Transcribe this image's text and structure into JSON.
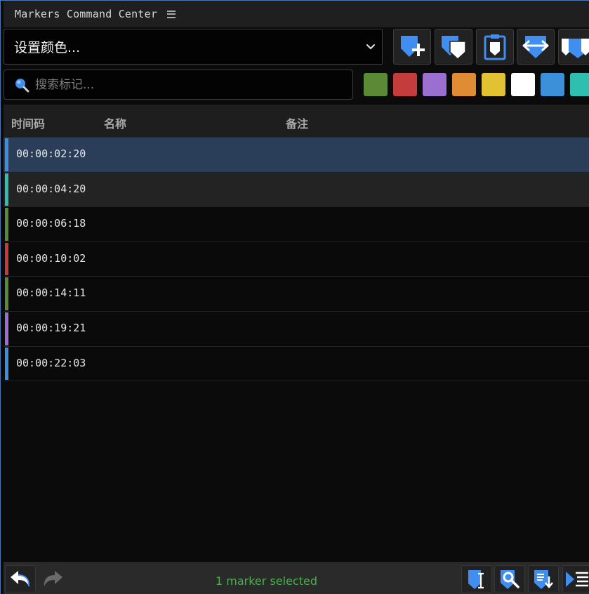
{
  "window": {
    "title": "Markers Command Center"
  },
  "toolbar": {
    "color_select": {
      "label": "设置颜色..."
    },
    "buttons": [
      {
        "name": "add-marker-button",
        "icon": "marker-add-icon"
      },
      {
        "name": "marker-button",
        "icon": "marker-icon"
      },
      {
        "name": "clipboard-marker-button",
        "icon": "clipboard-marker-icon"
      },
      {
        "name": "swap-marker-button",
        "icon": "marker-swap-icon"
      },
      {
        "name": "marker-range-button",
        "icon": "marker-range-icon"
      }
    ]
  },
  "search": {
    "placeholder": "搜索标记..."
  },
  "swatches": [
    "#5b8a36",
    "#c43c3c",
    "#9b6fcf",
    "#e08c34",
    "#e2c132",
    "#ffffff",
    "#3c8fd9",
    "#2fbfb0"
  ],
  "table": {
    "columns": {
      "timecode": "时间码",
      "name": "名称",
      "notes": "备注"
    },
    "rows": [
      {
        "timecode": "00:00:02:20",
        "color": "#3c8fd9",
        "state": "selected"
      },
      {
        "timecode": "00:00:04:20",
        "color": "#2fbfb0",
        "state": "alt"
      },
      {
        "timecode": "00:00:06:18",
        "color": "#5b8a36",
        "state": ""
      },
      {
        "timecode": "00:00:10:02",
        "color": "#c43c3c",
        "state": ""
      },
      {
        "timecode": "00:00:14:11",
        "color": "#5b8a36",
        "state": ""
      },
      {
        "timecode": "00:00:19:21",
        "color": "#9b6fcf",
        "state": ""
      },
      {
        "timecode": "00:00:22:03",
        "color": "#3c8fd9",
        "state": ""
      }
    ]
  },
  "status": {
    "text": "1 marker selected",
    "color": "#4caf50"
  },
  "accent": "#4a90e2"
}
